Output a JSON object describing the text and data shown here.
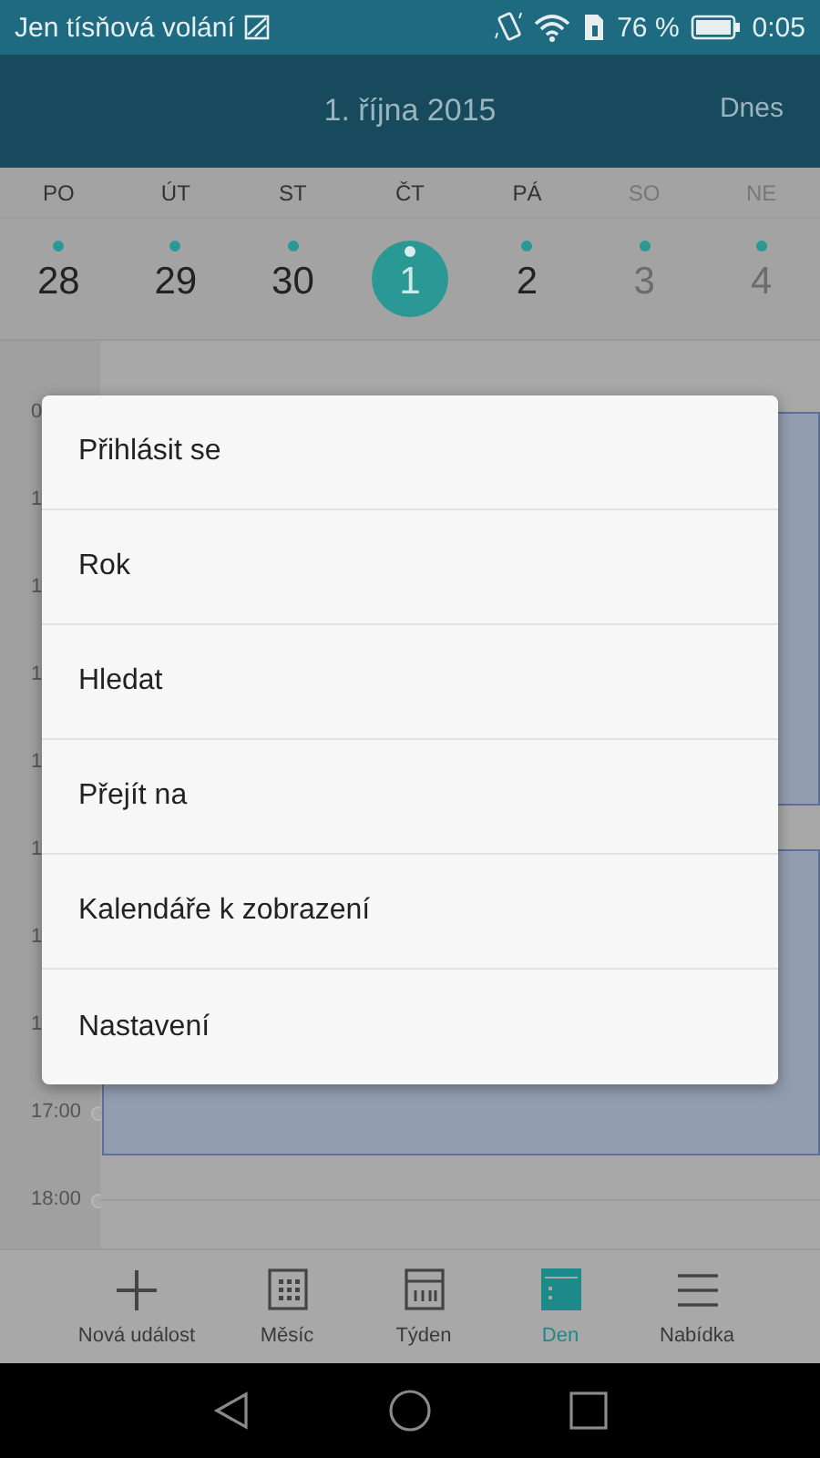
{
  "status_bar": {
    "carrier": "Jen tísňová volání",
    "battery": "76 %",
    "time": "0:05"
  },
  "header": {
    "title": "1. října 2015",
    "today_button": "Dnes"
  },
  "days": [
    {
      "weekday": "PO",
      "date": "28",
      "weekend": false,
      "selected": false,
      "has_events": true
    },
    {
      "weekday": "ÚT",
      "date": "29",
      "weekend": false,
      "selected": false,
      "has_events": true
    },
    {
      "weekday": "ST",
      "date": "30",
      "weekend": false,
      "selected": false,
      "has_events": true
    },
    {
      "weekday": "ČT",
      "date": "1",
      "weekend": false,
      "selected": true,
      "has_events": true
    },
    {
      "weekday": "PÁ",
      "date": "2",
      "weekend": false,
      "selected": false,
      "has_events": true
    },
    {
      "weekday": "SO",
      "date": "3",
      "weekend": true,
      "selected": false,
      "has_events": true
    },
    {
      "weekday": "NE",
      "date": "4",
      "weekend": true,
      "selected": false,
      "has_events": true
    }
  ],
  "hours": [
    "0",
    "1",
    "1",
    "1",
    "1",
    "1",
    "1",
    "1",
    "17:00",
    "18:00"
  ],
  "events": [
    {
      "kind": "event"
    },
    {
      "kind": "event"
    }
  ],
  "menu": [
    "Přihlásit se",
    "Rok",
    "Hledat",
    "Přejít na",
    "Kalendáře k zobrazení",
    "Nastavení"
  ],
  "bottom_nav": [
    {
      "kind": "add",
      "label": "Nová událost",
      "selected": false
    },
    {
      "kind": "month",
      "label": "Měsíc",
      "selected": false
    },
    {
      "kind": "week",
      "label": "Týden",
      "selected": false
    },
    {
      "kind": "day",
      "label": "Den",
      "selected": true
    },
    {
      "kind": "menu",
      "label": "Nabídka",
      "selected": false
    }
  ]
}
